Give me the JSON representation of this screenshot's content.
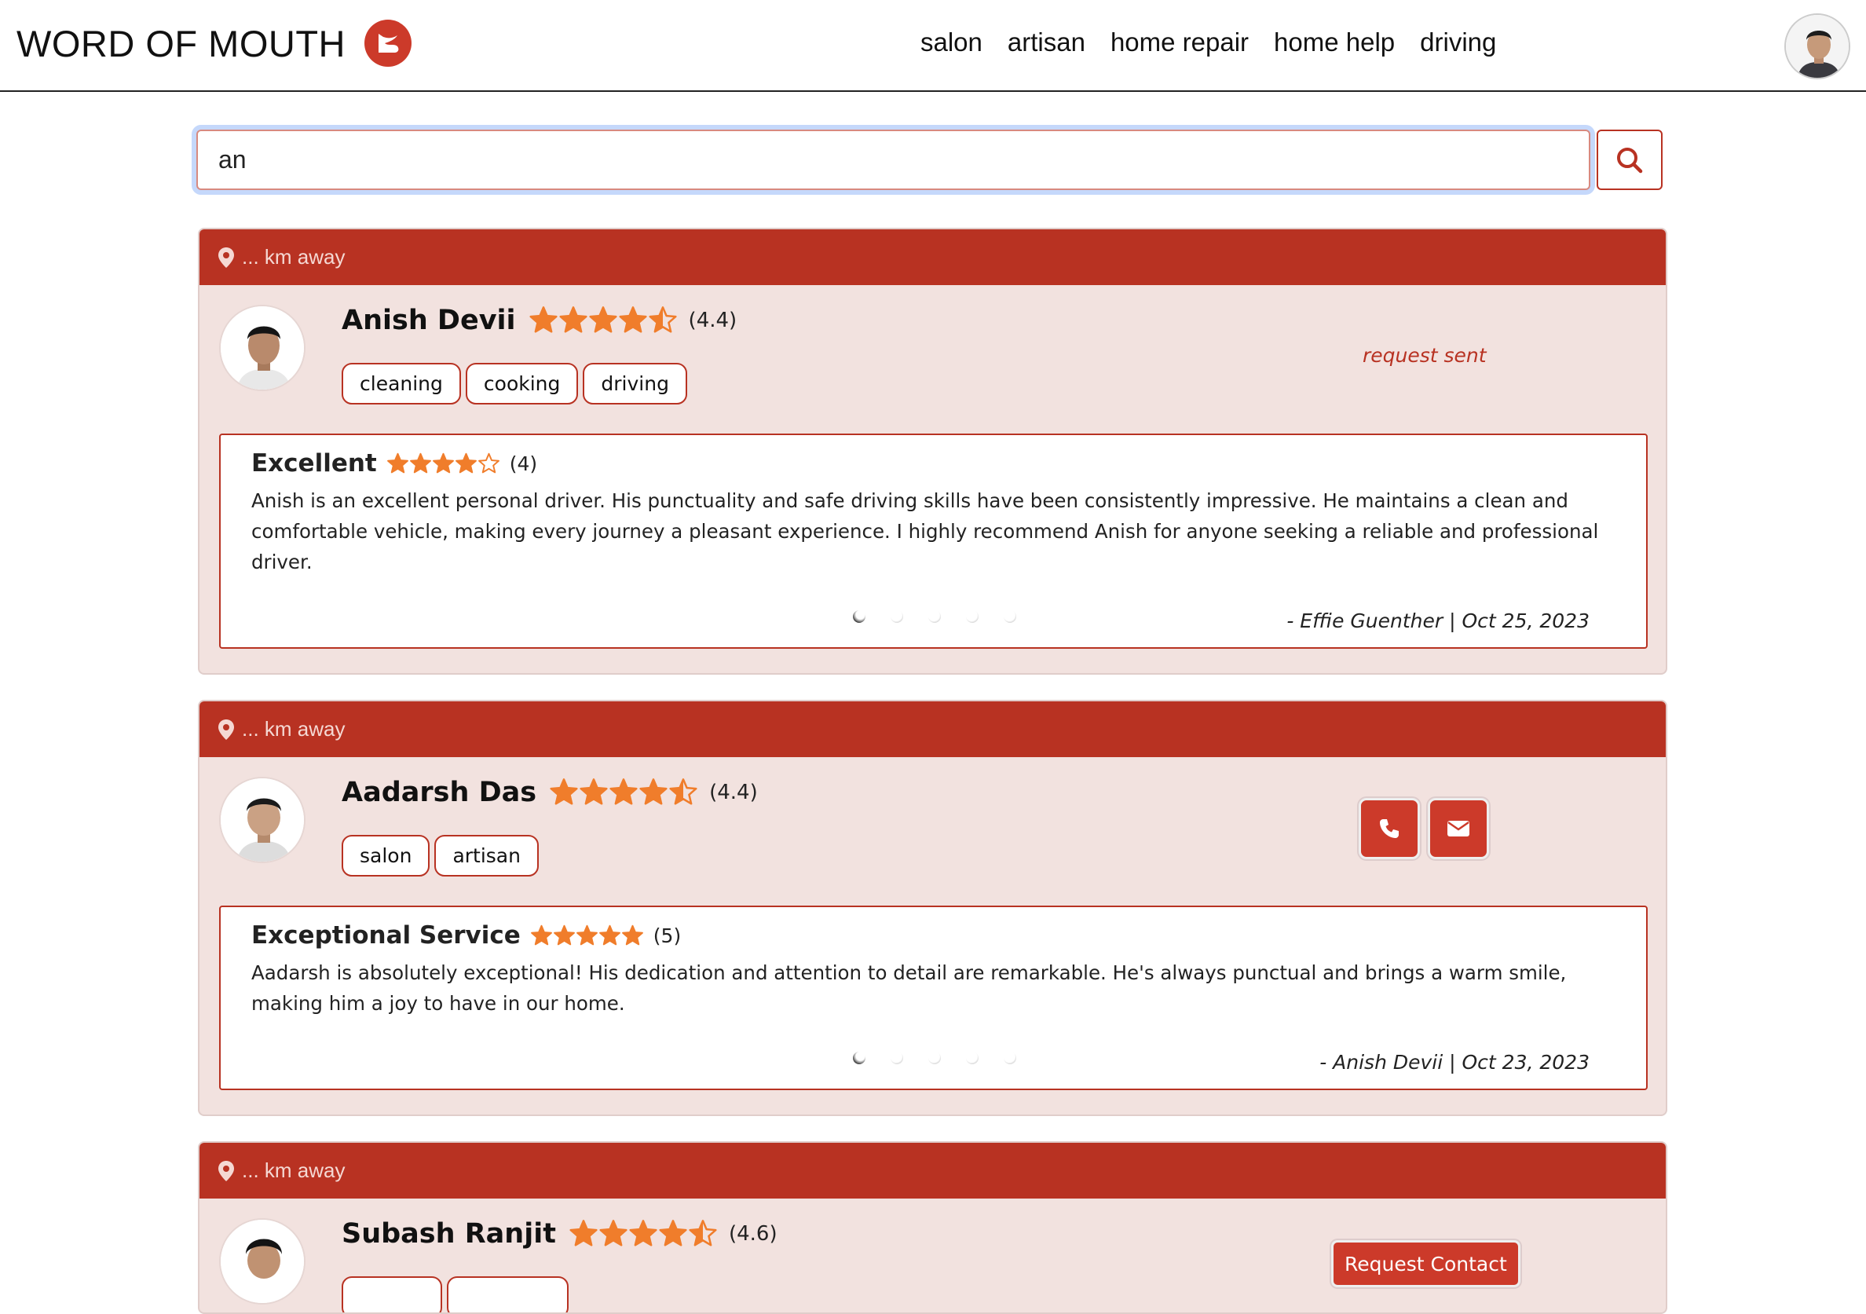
{
  "brand": {
    "name": "WORD OF MOUTH"
  },
  "nav": {
    "links": [
      "salon",
      "artisan",
      "home repair",
      "home help",
      "driving"
    ]
  },
  "search": {
    "value": "an",
    "placeholder": ""
  },
  "colors": {
    "primary": "#b83222",
    "card_bg": "#f2e2df",
    "star": "#f07d2b"
  },
  "cards": [
    {
      "distance": "... km away",
      "name": "Anish Devii",
      "rating": 4.4,
      "rating_text": "(4.4)",
      "tags": [
        "cleaning",
        "cooking",
        "driving"
      ],
      "status": "request sent",
      "review": {
        "title": "Excellent",
        "stars": 4,
        "rating_text": "(4)",
        "body": "Anish is an excellent personal driver. His punctuality and safe driving skills have been consistently impressive. He maintains a clean and comfortable vehicle, making every journey a pleasant experience. I highly recommend Anish for anyone seeking a reliable and professional driver.",
        "author_date": "- Effie Guenther  |  Oct 25, 2023",
        "dots": 5
      }
    },
    {
      "distance": "... km away",
      "name": "Aadarsh Das",
      "rating": 4.4,
      "rating_text": "(4.4)",
      "tags": [
        "salon",
        "artisan"
      ],
      "contact_icons": [
        "phone-icon",
        "envelope-icon"
      ],
      "review": {
        "title": "Exceptional Service",
        "stars": 5,
        "rating_text": "(5)",
        "body": "Aadarsh is absolutely exceptional! His dedication and attention to detail are remarkable. He's always punctual and brings a warm smile, making him a joy to have in our home.",
        "author_date": "- Anish Devii  |  Oct 23, 2023",
        "dots": 5
      }
    },
    {
      "distance": "... km away",
      "name": "Subash Ranjit",
      "rating": 4.6,
      "rating_text": "(4.6)",
      "button": "Request Contact"
    }
  ]
}
